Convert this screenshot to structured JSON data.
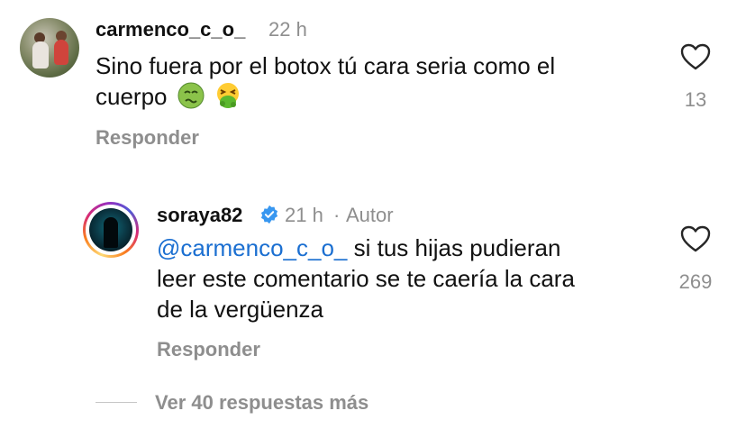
{
  "comment1": {
    "username": "carmenco_c_o_",
    "time": "22 h",
    "text": "Sino fuera por el botox tú cara seria como el",
    "text_line2": "cuerpo",
    "emojis": [
      "nauseated-face",
      "face-vomiting"
    ],
    "likes": "13",
    "reply_label": "Responder"
  },
  "comment2": {
    "username": "soraya82",
    "time": "21 h",
    "separator": "·",
    "author_tag": "Autor",
    "mention": "@carmenco_c_o_",
    "text_line1": " si tus hijas pudieran",
    "text_line2": "leer este comentario se te caería la cara",
    "text_line3": "de la vergüenza",
    "likes": "269",
    "reply_label": "Responder"
  },
  "view_more": "Ver 40 respuestas más",
  "colors": {
    "mention": "#1b6fd1",
    "secondary": "#8e8e8e",
    "verified": "#3897f0"
  }
}
